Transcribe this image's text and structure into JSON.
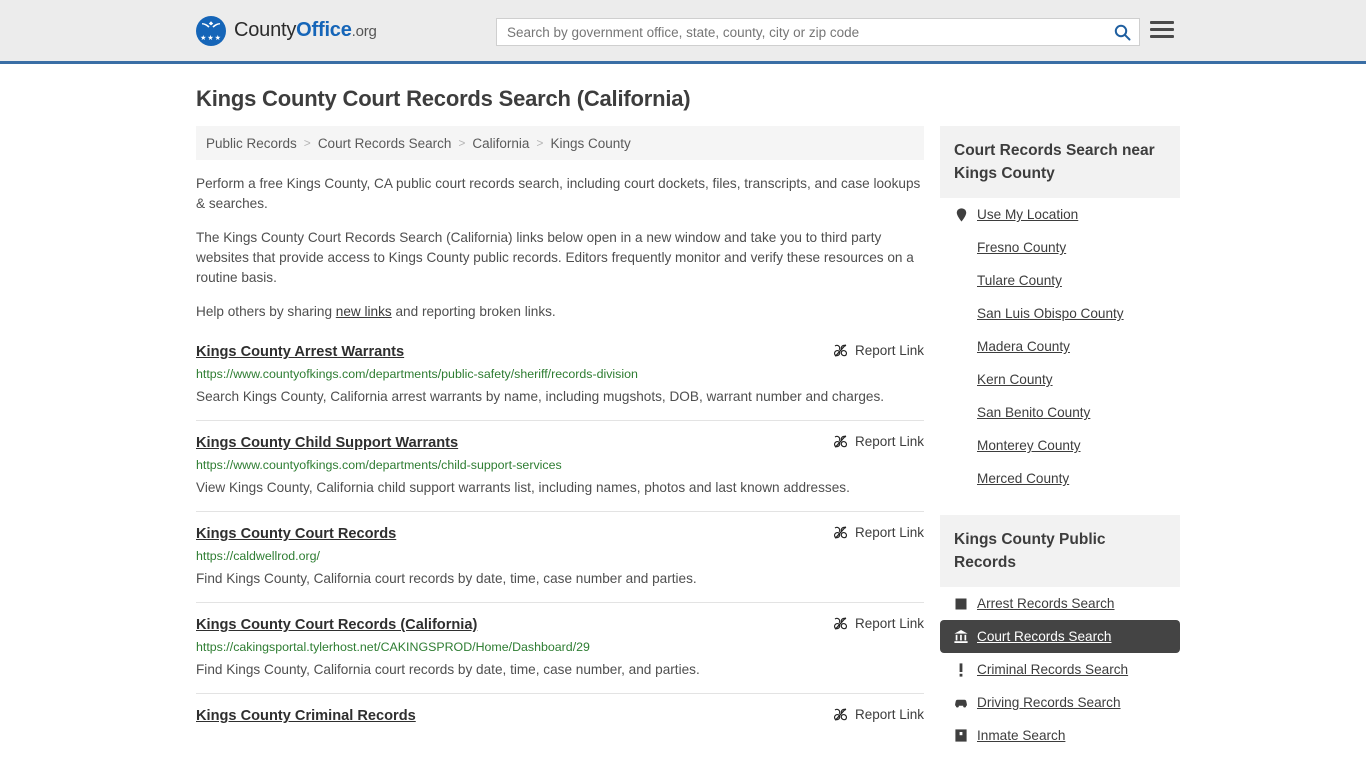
{
  "header": {
    "logo": {
      "part1": "County",
      "part2": "Office",
      "tld": ".org",
      "icon": "eagle-logo-icon",
      "stars": "★★★"
    },
    "search": {
      "placeholder": "Search by government office, state, county, city or zip code",
      "value": "",
      "button_icon": "search-icon"
    },
    "menu_icon": "hamburger-menu-icon",
    "accent_color": "#3a6ea5"
  },
  "page_title": "Kings County Court Records Search (California)",
  "breadcrumb": {
    "items": [
      {
        "label": "Public Records"
      },
      {
        "label": "Court Records Search"
      },
      {
        "label": "California"
      },
      {
        "label": "Kings County"
      }
    ],
    "separator": ">"
  },
  "intro": {
    "p1": "Perform a free Kings County, CA public court records search, including court dockets, files, transcripts, and case lookups & searches.",
    "p2": "The Kings County Court Records Search (California) links below open in a new window and take you to third party websites that provide access to Kings County public records. Editors frequently monitor and verify these resources on a routine basis.",
    "p3_before": "Help others by sharing ",
    "p3_link": "new links",
    "p3_after": " and reporting broken links."
  },
  "report_link": {
    "label": "Report Link",
    "icon": "broken-link-icon"
  },
  "results": [
    {
      "title": "Kings County Arrest Warrants",
      "url": "https://www.countyofkings.com/departments/public-safety/sheriff/records-division",
      "description": "Search Kings County, California arrest warrants by name, including mugshots, DOB, warrant number and charges."
    },
    {
      "title": "Kings County Child Support Warrants",
      "url": "https://www.countyofkings.com/departments/child-support-services",
      "description": "View Kings County, California child support warrants list, including names, photos and last known addresses."
    },
    {
      "title": "Kings County Court Records",
      "url": "https://caldwellrod.org/",
      "description": "Find Kings County, California court records by date, time, case number and parties."
    },
    {
      "title": "Kings County Court Records (California)",
      "url": "https://cakingsportal.tylerhost.net/CAKINGSPROD/Home/Dashboard/29",
      "description": "Find Kings County, California court records by date, time, case number, and parties."
    },
    {
      "title": "Kings County Criminal Records",
      "url": "",
      "description": ""
    }
  ],
  "sidebar": {
    "nearby": {
      "heading": "Court Records Search near Kings County",
      "items": [
        {
          "label": "Use My Location",
          "icon": "map-pin-icon",
          "active": false
        },
        {
          "label": "Fresno County",
          "icon": "",
          "active": false
        },
        {
          "label": "Tulare County",
          "icon": "",
          "active": false
        },
        {
          "label": "San Luis Obispo County",
          "icon": "",
          "active": false
        },
        {
          "label": "Madera County",
          "icon": "",
          "active": false
        },
        {
          "label": "Kern County",
          "icon": "",
          "active": false
        },
        {
          "label": "San Benito County",
          "icon": "",
          "active": false
        },
        {
          "label": "Monterey County",
          "icon": "",
          "active": false
        },
        {
          "label": "Merced County",
          "icon": "",
          "active": false
        }
      ]
    },
    "public_records": {
      "heading": "Kings County Public Records",
      "items": [
        {
          "label": "Arrest Records Search",
          "icon": "square-icon",
          "active": false
        },
        {
          "label": "Court Records Search",
          "icon": "courthouse-icon",
          "active": true
        },
        {
          "label": "Criminal Records Search",
          "icon": "exclamation-icon",
          "active": false
        },
        {
          "label": "Driving Records Search",
          "icon": "car-icon",
          "active": false
        },
        {
          "label": "Inmate Search",
          "icon": "jail-icon",
          "active": false
        }
      ]
    }
  }
}
